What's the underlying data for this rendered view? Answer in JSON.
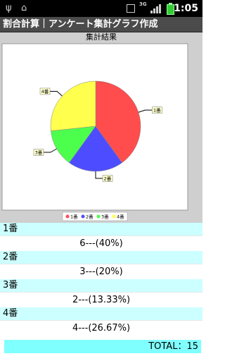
{
  "status_bar": {
    "time": "1:05",
    "network": "3G"
  },
  "app": {
    "title": "割合計算｜アンケート集計グラフ作成"
  },
  "chart_data": {
    "type": "pie",
    "title": "集計結果",
    "categories": [
      "1番",
      "2番",
      "3番",
      "4番"
    ],
    "values": [
      6,
      3,
      2,
      4
    ],
    "colors": [
      "#ff4d4d",
      "#4d4dff",
      "#4dff4d",
      "#ffff4d"
    ],
    "legend_position": "bottom"
  },
  "results": [
    {
      "label": "1番",
      "value": "6---(40%)"
    },
    {
      "label": "2番",
      "value": "3---(20%)"
    },
    {
      "label": "3番",
      "value": "2---(13.33%)"
    },
    {
      "label": "4番",
      "value": "4---(26.67%)"
    }
  ],
  "total": "TOTAL：15"
}
